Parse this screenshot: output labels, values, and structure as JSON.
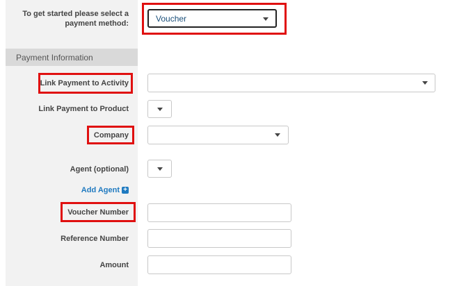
{
  "payment_method": {
    "prompt": "To get started please select a payment method:",
    "selected_value": "Voucher"
  },
  "section": {
    "title": "Payment Information"
  },
  "fields": {
    "link_activity_label": "Link Payment to Activity",
    "link_product_label": "Link Payment to Product",
    "company_label": "Company",
    "agent_label": "Agent (optional)",
    "add_agent_label": "Add Agent",
    "voucher_number_label": "Voucher Number",
    "reference_number_label": "Reference Number",
    "amount_label": "Amount"
  },
  "icons": {
    "plus": "plus-icon",
    "dropdown": "caret-down-icon"
  },
  "colors": {
    "highlight_red": "#e01010",
    "link_blue": "#1f7ac0"
  }
}
